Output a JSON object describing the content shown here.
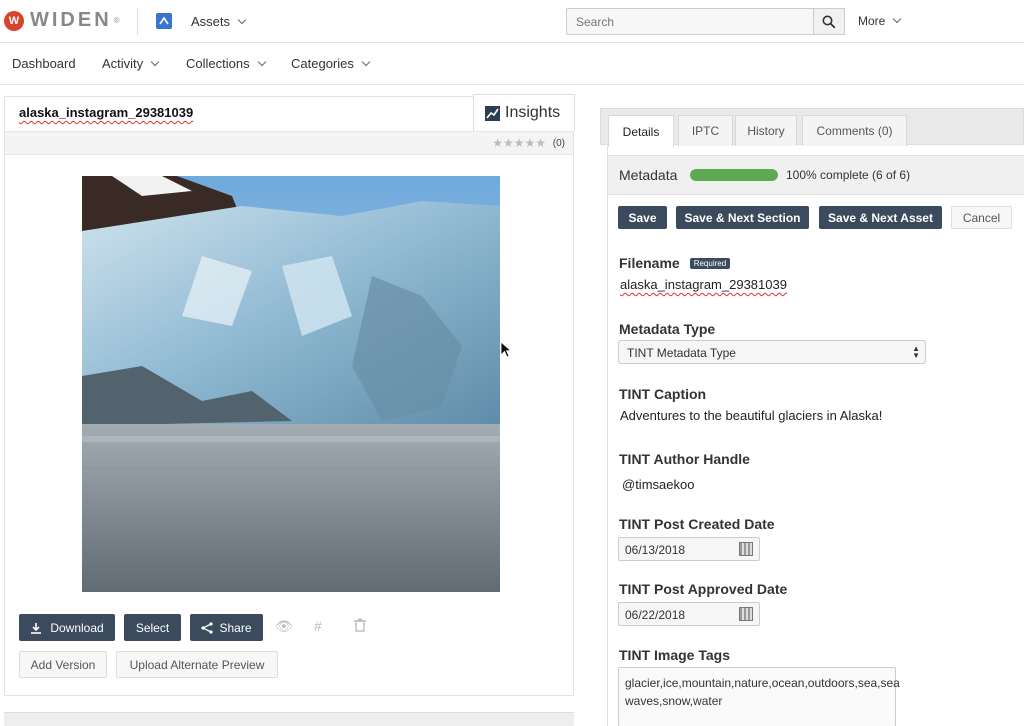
{
  "brand": {
    "name": "WIDEN",
    "mark": "®"
  },
  "header": {
    "app_label": "Assets",
    "search_placeholder": "Search",
    "more_label": "More"
  },
  "nav": [
    "Dashboard",
    "Activity",
    "Collections",
    "Categories"
  ],
  "asset": {
    "title": "alaska_instagram_29381039",
    "insights_label": "Insights",
    "rating_count": "(0)",
    "rating_stars": 0,
    "actions": {
      "download": "Download",
      "select": "Select",
      "share": "Share",
      "add_version": "Add Version",
      "upload_alternate": "Upload Alternate Preview"
    }
  },
  "detail_tabs": [
    "Details",
    "IPTC",
    "History",
    "Comments (0)"
  ],
  "metadata": {
    "label": "Metadata",
    "progress_fraction": 1.0,
    "progress_text": "100% complete (6 of 6)",
    "buttons": {
      "save": "Save",
      "save_next_section": "Save & Next Section",
      "save_next_asset": "Save & Next Asset",
      "cancel": "Cancel"
    },
    "required_badge": "Required",
    "fields": {
      "filename_label": "Filename",
      "filename_value": "alaska_instagram_29381039",
      "type_label": "Metadata Type",
      "type_value": "TINT Metadata Type",
      "caption_label": "TINT Caption",
      "caption_value": "Adventures to the beautiful glaciers in Alaska!",
      "author_label": "TINT Author Handle",
      "author_value": "@timsaekoo",
      "created_label": "TINT Post Created Date",
      "created_value": "06/13/2018",
      "approved_label": "TINT Post Approved Date",
      "approved_value": "06/22/2018",
      "tags_label": "TINT Image Tags",
      "tags_value": "glacier,ice,mountain,nature,ocean,outdoors,sea,sea waves,snow,water"
    }
  },
  "colors": {
    "brand_red": "#d8432c",
    "button_dark": "#3b4a5c",
    "progress_green": "#5eaa52",
    "app_blue": "#3b73d1"
  }
}
